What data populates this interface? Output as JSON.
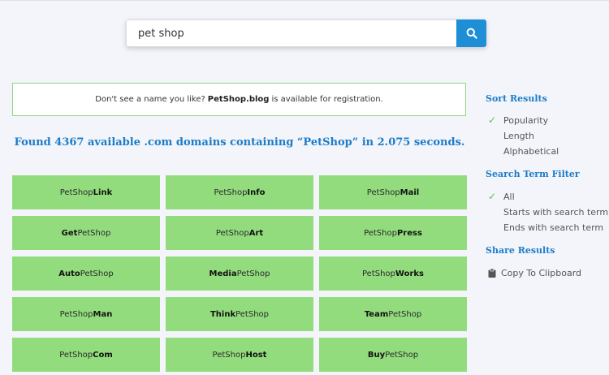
{
  "search": {
    "value": "pet shop"
  },
  "notice": {
    "prefix": "Don't see a name you like?",
    "domain": "PetShop.blog",
    "suffix": "is available for registration."
  },
  "found_text": "Found 4367 available .com domains containing “PetShop” in 2.075 seconds.",
  "domains": [
    {
      "a": "PetShop",
      "b": "Link",
      "bold": "b"
    },
    {
      "a": "PetShop",
      "b": "Info",
      "bold": "b"
    },
    {
      "a": "PetShop",
      "b": "Mail",
      "bold": "b"
    },
    {
      "a": "Get",
      "b": "PetShop",
      "bold": "a"
    },
    {
      "a": "PetShop",
      "b": "Art",
      "bold": "b"
    },
    {
      "a": "PetShop",
      "b": "Press",
      "bold": "b"
    },
    {
      "a": "Auto",
      "b": "PetShop",
      "bold": "a"
    },
    {
      "a": "Media",
      "b": "PetShop",
      "bold": "a"
    },
    {
      "a": "PetShop",
      "b": "Works",
      "bold": "b"
    },
    {
      "a": "PetShop",
      "b": "Man",
      "bold": "b"
    },
    {
      "a": "Think",
      "b": "PetShop",
      "bold": "a"
    },
    {
      "a": "Team",
      "b": "PetShop",
      "bold": "a"
    },
    {
      "a": "PetShop",
      "b": "Com",
      "bold": "b"
    },
    {
      "a": "PetShop",
      "b": "Host",
      "bold": "b"
    },
    {
      "a": "Buy",
      "b": "PetShop",
      "bold": "a"
    }
  ],
  "sidebar": {
    "sort_title": "Sort Results",
    "sort": {
      "popularity": "Popularity",
      "length": "Length",
      "alphabetical": "Alphabetical"
    },
    "filter_title": "Search Term Filter",
    "filter": {
      "all": "All",
      "starts": "Starts with search term",
      "ends": "Ends with search term"
    },
    "share_title": "Share Results",
    "copy": "Copy To Clipboard"
  },
  "colors": {
    "accent": "#1e8fd6",
    "tile": "#92dc7e",
    "check": "#5cc44a"
  }
}
